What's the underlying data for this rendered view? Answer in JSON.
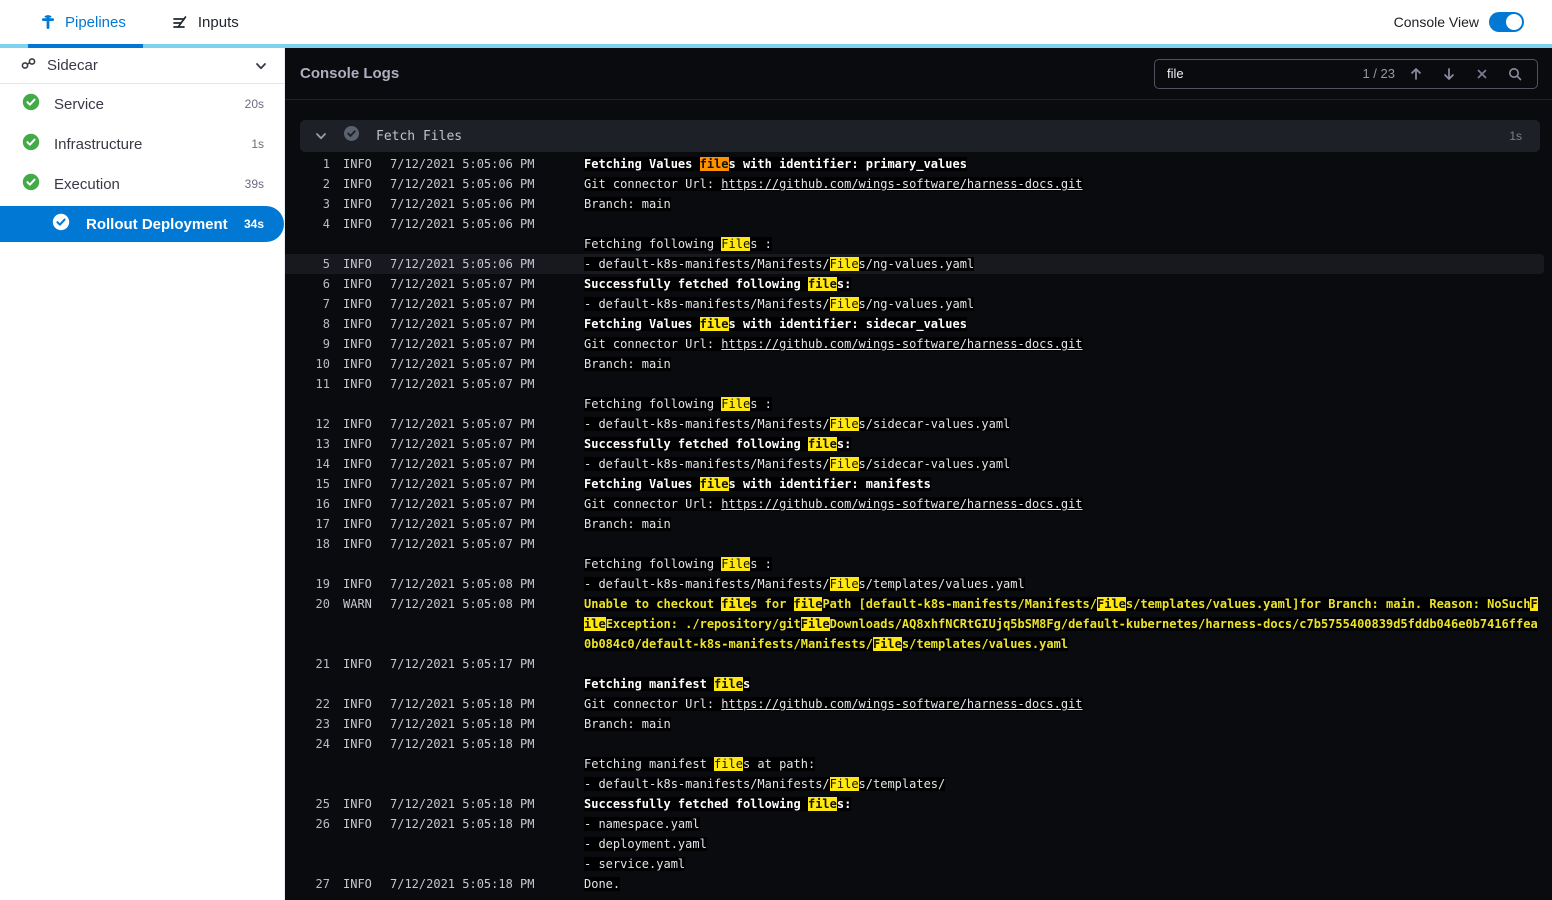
{
  "topnav": {
    "tabs": [
      {
        "label": "Pipelines",
        "active": true,
        "icon": "pipeline-icon"
      },
      {
        "label": "Inputs",
        "active": false,
        "icon": "inputs-icon"
      }
    ],
    "console_view_label": "Console View",
    "console_view_on": true
  },
  "sidebar": {
    "group_label": "Sidecar",
    "stages": [
      {
        "label": "Service",
        "duration": "20s",
        "status": "success",
        "selected": false
      },
      {
        "label": "Infrastructure",
        "duration": "1s",
        "status": "success",
        "selected": false
      },
      {
        "label": "Execution",
        "duration": "39s",
        "status": "success",
        "selected": false
      },
      {
        "label": "Rollout Deployment",
        "duration": "34s",
        "status": "success",
        "selected": true
      }
    ]
  },
  "console": {
    "title": "Console Logs",
    "search": {
      "value": "file",
      "counter": "1 / 23"
    },
    "section": {
      "title": "Fetch Files",
      "duration": "1s"
    },
    "colors": {
      "accent_blue": "#0278d5",
      "cyan_bar": "#7fd1f0",
      "success_green": "#42ab45",
      "highlight_yellow": "#ffe714",
      "highlight_current": "#ff9100",
      "warn_yellow": "#ebe32a"
    },
    "rows": [
      {
        "n": "1",
        "lvl": "INFO",
        "time": "7/12/2021 5:05:06 PM",
        "bold": true,
        "seg": [
          {
            "t": "Fetching Values "
          },
          {
            "t": "file",
            "h": "o"
          },
          {
            "t": "s with identifier: primary_values"
          }
        ]
      },
      {
        "n": "2",
        "lvl": "INFO",
        "time": "7/12/2021 5:05:06 PM",
        "seg": [
          {
            "t": "Git connector Url: "
          },
          {
            "t": "https://github.com/wings-software/harness-docs.git",
            "u": true
          }
        ]
      },
      {
        "n": "3",
        "lvl": "INFO",
        "time": "7/12/2021 5:05:06 PM",
        "seg": [
          {
            "t": "Branch: main"
          }
        ]
      },
      {
        "n": "4",
        "lvl": "INFO",
        "time": "7/12/2021 5:05:06 PM",
        "seg": []
      },
      {
        "cont": true,
        "seg": [
          {
            "t": "Fetching following "
          },
          {
            "t": "File",
            "h": "y"
          },
          {
            "t": "s :"
          }
        ]
      },
      {
        "n": "5",
        "lvl": "INFO",
        "time": "7/12/2021 5:05:06 PM",
        "marked": true,
        "seg": [
          {
            "t": "- default-k8s-manifests/Manifests/"
          },
          {
            "t": "File",
            "h": "y"
          },
          {
            "t": "s/ng-values.yaml"
          }
        ]
      },
      {
        "n": "6",
        "lvl": "INFO",
        "time": "7/12/2021 5:05:07 PM",
        "bold": true,
        "seg": [
          {
            "t": "Successfully fetched following "
          },
          {
            "t": "file",
            "h": "y"
          },
          {
            "t": "s:"
          }
        ]
      },
      {
        "n": "7",
        "lvl": "INFO",
        "time": "7/12/2021 5:05:07 PM",
        "seg": [
          {
            "t": "- default-k8s-manifests/Manifests/"
          },
          {
            "t": "File",
            "h": "y"
          },
          {
            "t": "s/ng-values.yaml"
          }
        ]
      },
      {
        "n": "8",
        "lvl": "INFO",
        "time": "7/12/2021 5:05:07 PM",
        "bold": true,
        "seg": [
          {
            "t": "Fetching Values "
          },
          {
            "t": "file",
            "h": "y"
          },
          {
            "t": "s with identifier: sidecar_values"
          }
        ]
      },
      {
        "n": "9",
        "lvl": "INFO",
        "time": "7/12/2021 5:05:07 PM",
        "seg": [
          {
            "t": "Git connector Url: "
          },
          {
            "t": "https://github.com/wings-software/harness-docs.git",
            "u": true
          }
        ]
      },
      {
        "n": "10",
        "lvl": "INFO",
        "time": "7/12/2021 5:05:07 PM",
        "seg": [
          {
            "t": "Branch: main"
          }
        ]
      },
      {
        "n": "11",
        "lvl": "INFO",
        "time": "7/12/2021 5:05:07 PM",
        "seg": []
      },
      {
        "cont": true,
        "seg": [
          {
            "t": "Fetching following "
          },
          {
            "t": "File",
            "h": "y"
          },
          {
            "t": "s :"
          }
        ]
      },
      {
        "n": "12",
        "lvl": "INFO",
        "time": "7/12/2021 5:05:07 PM",
        "seg": [
          {
            "t": "- default-k8s-manifests/Manifests/"
          },
          {
            "t": "File",
            "h": "y"
          },
          {
            "t": "s/sidecar-values.yaml"
          }
        ]
      },
      {
        "n": "13",
        "lvl": "INFO",
        "time": "7/12/2021 5:05:07 PM",
        "bold": true,
        "seg": [
          {
            "t": "Successfully fetched following "
          },
          {
            "t": "file",
            "h": "y"
          },
          {
            "t": "s:"
          }
        ]
      },
      {
        "n": "14",
        "lvl": "INFO",
        "time": "7/12/2021 5:05:07 PM",
        "seg": [
          {
            "t": "- default-k8s-manifests/Manifests/"
          },
          {
            "t": "File",
            "h": "y"
          },
          {
            "t": "s/sidecar-values.yaml"
          }
        ]
      },
      {
        "n": "15",
        "lvl": "INFO",
        "time": "7/12/2021 5:05:07 PM",
        "bold": true,
        "seg": [
          {
            "t": "Fetching Values "
          },
          {
            "t": "file",
            "h": "y"
          },
          {
            "t": "s with identifier: manifests"
          }
        ]
      },
      {
        "n": "16",
        "lvl": "INFO",
        "time": "7/12/2021 5:05:07 PM",
        "seg": [
          {
            "t": "Git connector Url: "
          },
          {
            "t": "https://github.com/wings-software/harness-docs.git",
            "u": true
          }
        ]
      },
      {
        "n": "17",
        "lvl": "INFO",
        "time": "7/12/2021 5:05:07 PM",
        "seg": [
          {
            "t": "Branch: main"
          }
        ]
      },
      {
        "n": "18",
        "lvl": "INFO",
        "time": "7/12/2021 5:05:07 PM",
        "seg": []
      },
      {
        "cont": true,
        "seg": [
          {
            "t": "Fetching following "
          },
          {
            "t": "File",
            "h": "y"
          },
          {
            "t": "s :"
          }
        ]
      },
      {
        "n": "19",
        "lvl": "INFO",
        "time": "7/12/2021 5:05:08 PM",
        "seg": [
          {
            "t": "- default-k8s-manifests/Manifests/"
          },
          {
            "t": "File",
            "h": "y"
          },
          {
            "t": "s/templates/values.yaml"
          }
        ]
      },
      {
        "n": "20",
        "lvl": "WARN",
        "time": "7/12/2021 5:05:08 PM",
        "warn": true,
        "seg": [
          {
            "t": "Unable to checkout "
          },
          {
            "t": "file",
            "h": "y"
          },
          {
            "t": "s for "
          },
          {
            "t": "file",
            "h": "y"
          },
          {
            "t": "Path [default-k8s-manifests/Manifests/"
          },
          {
            "t": "File",
            "h": "y"
          },
          {
            "t": "s/templates/values.yaml]for Branch: main. Reason: NoSuch"
          },
          {
            "t": "File",
            "h": "y"
          },
          {
            "t": "Exception: ./repository/git"
          },
          {
            "t": "File",
            "h": "y"
          },
          {
            "t": "Downloads/AQ8xhfNCRtGIUjq5bSM8Fg/default-kubernetes/harness-docs/c7b5755400839d5fddb046e0b7416ffea0b084c0/default-k8s-manifests/Manifests/"
          },
          {
            "t": "File",
            "h": "y"
          },
          {
            "t": "s/templates/values.yaml"
          }
        ]
      },
      {
        "n": "21",
        "lvl": "INFO",
        "time": "7/12/2021 5:05:17 PM",
        "seg": []
      },
      {
        "cont": true,
        "bold": true,
        "seg": [
          {
            "t": "Fetching manifest "
          },
          {
            "t": "file",
            "h": "y"
          },
          {
            "t": "s"
          }
        ]
      },
      {
        "n": "22",
        "lvl": "INFO",
        "time": "7/12/2021 5:05:18 PM",
        "seg": [
          {
            "t": "Git connector Url: "
          },
          {
            "t": "https://github.com/wings-software/harness-docs.git",
            "u": true
          }
        ]
      },
      {
        "n": "23",
        "lvl": "INFO",
        "time": "7/12/2021 5:05:18 PM",
        "seg": [
          {
            "t": "Branch: main"
          }
        ]
      },
      {
        "n": "24",
        "lvl": "INFO",
        "time": "7/12/2021 5:05:18 PM",
        "seg": []
      },
      {
        "cont": true,
        "seg": [
          {
            "t": "Fetching manifest "
          },
          {
            "t": "file",
            "h": "y"
          },
          {
            "t": "s at path:"
          }
        ]
      },
      {
        "cont": true,
        "seg": [
          {
            "t": "- default-k8s-manifests/Manifests/"
          },
          {
            "t": "File",
            "h": "y"
          },
          {
            "t": "s/templates/"
          }
        ]
      },
      {
        "n": "25",
        "lvl": "INFO",
        "time": "7/12/2021 5:05:18 PM",
        "bold": true,
        "seg": [
          {
            "t": "Successfully fetched following "
          },
          {
            "t": "file",
            "h": "y"
          },
          {
            "t": "s:"
          }
        ]
      },
      {
        "n": "26",
        "lvl": "INFO",
        "time": "7/12/2021 5:05:18 PM",
        "seg": [
          {
            "t": "- namespace.yaml"
          }
        ]
      },
      {
        "cont": true,
        "seg": [
          {
            "t": "- deployment.yaml"
          }
        ]
      },
      {
        "cont": true,
        "seg": [
          {
            "t": "- service.yaml"
          }
        ]
      },
      {
        "n": "27",
        "lvl": "INFO",
        "time": "7/12/2021 5:05:18 PM",
        "seg": [
          {
            "t": "Done."
          }
        ]
      }
    ]
  }
}
